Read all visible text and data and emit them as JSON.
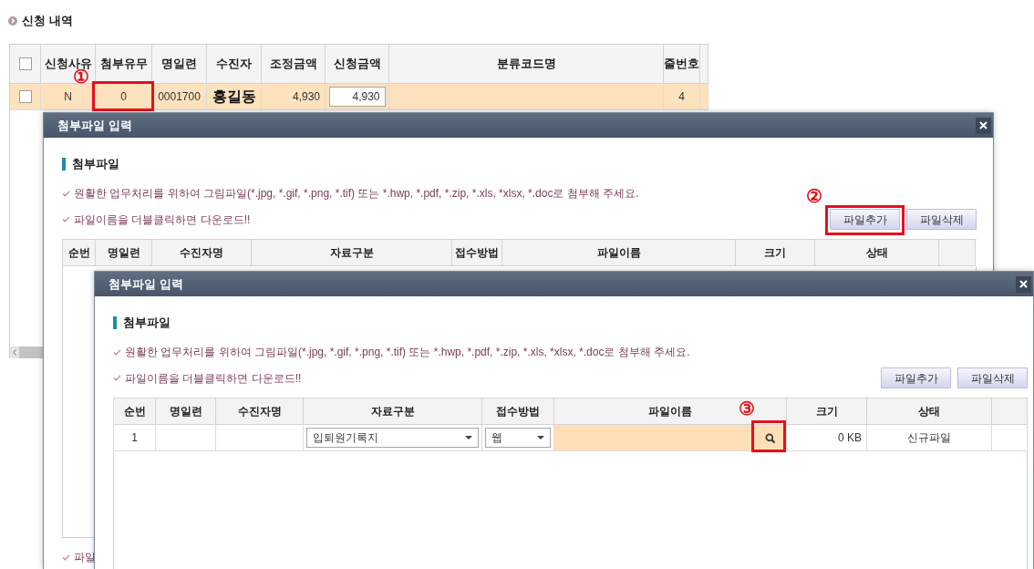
{
  "page": {
    "title": "신청 내역",
    "table": {
      "columns": [
        {
          "kind": "checkbox",
          "checked": false
        },
        {
          "kind": "text",
          "label": "신청사유"
        },
        {
          "kind": "text",
          "label": "첨부유무"
        },
        {
          "kind": "text",
          "label": "명일련"
        },
        {
          "kind": "text",
          "label": "수진자"
        },
        {
          "kind": "text",
          "label": "조정금액"
        },
        {
          "kind": "text",
          "label": "신청금액"
        },
        {
          "kind": "text",
          "label": "분류코드명"
        },
        {
          "kind": "text",
          "label": "줄번호"
        },
        {
          "kind": "blank"
        }
      ],
      "rows": [
        {
          "selected": true,
          "cells": [
            {
              "kind": "checkbox",
              "checked": false
            },
            {
              "kind": "text",
              "text": "N"
            },
            {
              "kind": "text",
              "text": "0"
            },
            {
              "kind": "text",
              "text": "0001700"
            },
            {
              "kind": "name",
              "text": "홍길동"
            },
            {
              "kind": "number",
              "text": "4,930"
            },
            {
              "kind": "input",
              "value": "4,930"
            },
            {
              "kind": "blank"
            },
            {
              "kind": "text",
              "text": "4"
            },
            {
              "kind": "blank"
            }
          ]
        }
      ]
    }
  },
  "dialogs": [
    {
      "title": "첨부파일 입력",
      "section_title": "첨부파일",
      "notes": [
        "원활한 업무처리를 위하여 그림파일(*.jpg, *.gif, *.png, *.tif) 또는 *.hwp, *.pdf, *.zip, *.xls, *xlsx, *.doc로 첨부해 주세요.",
        "파일이름을 더블클릭하면 다운로드!!"
      ],
      "buttons": [
        {
          "label": "파일추가"
        },
        {
          "label": "파일삭제"
        }
      ],
      "table": {
        "columns": [
          {
            "kind": "text",
            "label": "순번"
          },
          {
            "kind": "text",
            "label": "명일련"
          },
          {
            "kind": "text",
            "label": "수진자명"
          },
          {
            "kind": "text",
            "label": "자료구분"
          },
          {
            "kind": "text",
            "label": "접수방법"
          },
          {
            "kind": "text",
            "label": "파일이름"
          },
          {
            "kind": "text",
            "label": "크기"
          },
          {
            "kind": "text",
            "label": "상태"
          },
          {
            "kind": "blank"
          }
        ]
      },
      "footnotes": [
        "파일"
      ]
    },
    {
      "title": "첨부파일 입력",
      "section_title": "첨부파일",
      "notes": [
        "원활한 업무처리를 위하여 그림파일(*.jpg, *.gif, *.png, *.tif) 또는 *.hwp, *.pdf, *.zip, *.xls, *xlsx, *.doc로 첨부해 주세요.",
        "파일이름을 더블클릭하면 다운로드!!"
      ],
      "buttons": [
        {
          "label": "파일추가"
        },
        {
          "label": "파일삭제"
        }
      ],
      "table": {
        "columns": [
          {
            "kind": "text",
            "label": "순번"
          },
          {
            "kind": "text",
            "label": "명일련"
          },
          {
            "kind": "text",
            "label": "수진자명"
          },
          {
            "kind": "text",
            "label": "자료구분"
          },
          {
            "kind": "text",
            "label": "접수방법"
          },
          {
            "kind": "text",
            "label": "파일이름"
          },
          {
            "kind": "text",
            "label": "크기"
          },
          {
            "kind": "text",
            "label": "상태"
          },
          {
            "kind": "blank"
          }
        ],
        "rows": [
          {
            "cells": [
              {
                "kind": "text",
                "text": "1"
              },
              {
                "kind": "blank"
              },
              {
                "kind": "blank"
              },
              {
                "kind": "select",
                "value": "입퇴원기록지"
              },
              {
                "kind": "select",
                "value": "웹"
              },
              {
                "kind": "file"
              },
              {
                "kind": "number",
                "text": "0 KB"
              },
              {
                "kind": "text",
                "text": "신규파일"
              },
              {
                "kind": "blank"
              }
            ]
          }
        ]
      }
    }
  ],
  "annotations": [
    {
      "number": "①"
    },
    {
      "number": "②"
    },
    {
      "number": "③"
    }
  ]
}
